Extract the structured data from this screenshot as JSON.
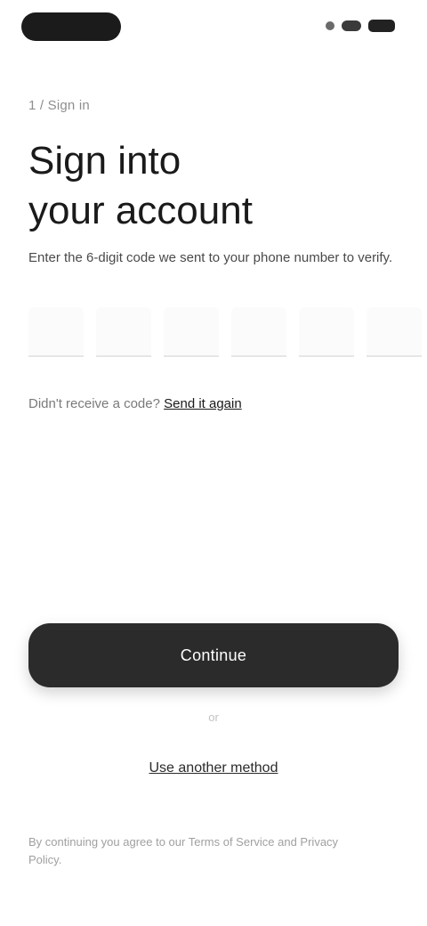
{
  "status_bar": {
    "time": "",
    "icons": [
      "signal-icon",
      "wifi-icon",
      "battery-icon"
    ]
  },
  "header": {
    "step": "1 / Sign in",
    "title_line1": "Sign into",
    "title_line2": "your account"
  },
  "body": {
    "subtitle": "Enter the 6-digit code we sent to your phone number to verify.",
    "code_digits": [
      "",
      "",
      "",
      "",
      "",
      ""
    ],
    "resend_prefix": "Didn't receive a code? ",
    "resend_link": "Send it again"
  },
  "actions": {
    "primary_label": "Continue",
    "divider": "or",
    "secondary_label": "Use another method"
  },
  "footer": {
    "note": "By continuing you agree to our Terms of Service and Privacy Policy."
  },
  "colors": {
    "primary": "#2b2b2b",
    "background": "#ffffff",
    "muted": "#8e8e8e"
  }
}
